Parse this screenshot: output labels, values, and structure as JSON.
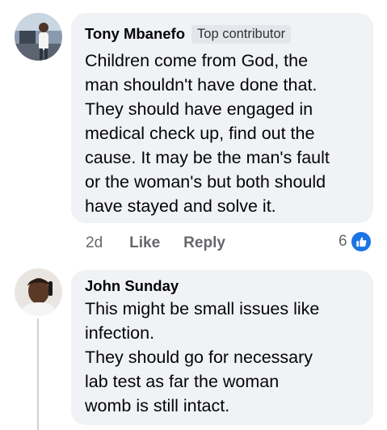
{
  "comments": [
    {
      "author": "Tony Mbanefo",
      "badge": "Top contributor",
      "lines": [
        "Children come from God, the",
        "man shouldn't have done that.",
        "They should have engaged in",
        "medical check up, find out the",
        "cause. It may be the man's fault",
        "or the woman's but both should",
        "have stayed and solve it."
      ],
      "time": "2d",
      "like_label": "Like",
      "reply_label": "Reply",
      "reaction_count": "6",
      "reaction_icon": "thumbs-up-icon",
      "reaction_color": "#1b74e4"
    },
    {
      "author": "John Sunday",
      "lines": [
        "This might be small issues like",
        "infection.",
        "They should go for necessary",
        "lab test as far  the woman",
        "womb is still intact."
      ]
    }
  ],
  "colors": {
    "bubble": "#f0f2f5",
    "meta_text": "#65676b",
    "thread_line": "#ced0d4"
  }
}
